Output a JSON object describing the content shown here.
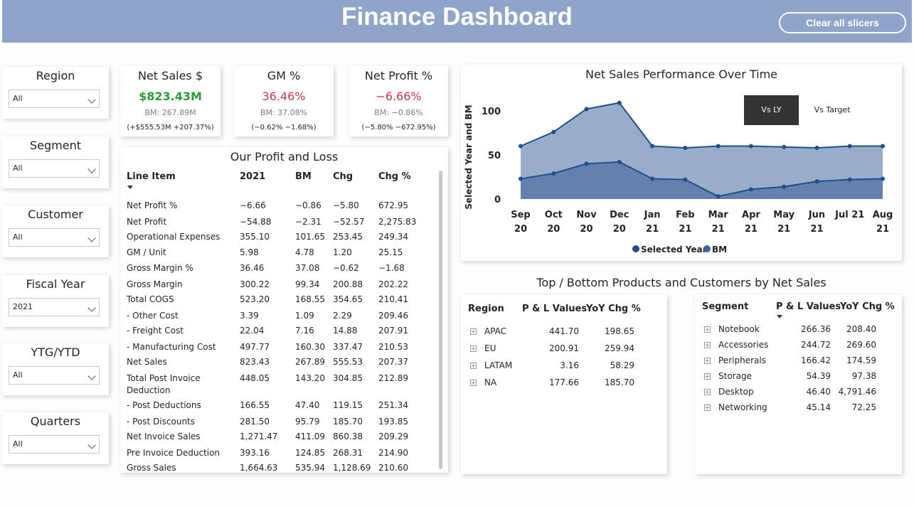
{
  "header": {
    "title": "Finance Dashboard",
    "clear_button": "Clear all slicers"
  },
  "slicers": [
    {
      "title": "Region",
      "value": "All"
    },
    {
      "title": "Segment",
      "value": "All"
    },
    {
      "title": "Customer",
      "value": "All"
    },
    {
      "title": "Fiscal Year",
      "value": "2021"
    },
    {
      "title": "YTG/YTD",
      "value": "All"
    },
    {
      "title": "Quarters",
      "value": "All"
    }
  ],
  "kpis": [
    {
      "title": "Net Sales $",
      "value": "$823.43M",
      "bm": "BM: 267.89M",
      "change": "(+$555.53M +207.37%)",
      "color": "#2e9a3e"
    },
    {
      "title": "GM %",
      "value": "36.46%",
      "bm": "BM: 37.08%",
      "change": "(−0.62% −1.68%)",
      "color": "#c9384a"
    },
    {
      "title": "Net Profit %",
      "value": "−6.66%",
      "bm": "BM: −0.86%",
      "change": "(−5.80% −672.95%)",
      "color": "#c9384a"
    }
  ],
  "pl": {
    "title": "Our Profit and Loss",
    "headers": [
      "Line Item",
      "2021",
      "BM",
      "Chg",
      "Chg %"
    ],
    "rows": [
      [
        "Net Profit %",
        "−6.66",
        "−0.86",
        "−5.80",
        "672.95"
      ],
      [
        "Net Profit",
        "−54.88",
        "−2.31",
        "−52.57",
        "2,275.83"
      ],
      [
        "Operational Expenses",
        "355.10",
        "101.65",
        "253.45",
        "249.34"
      ],
      [
        "GM / Unit",
        "5.98",
        "4.78",
        "1.20",
        "25.15"
      ],
      [
        "Gross Margin %",
        "36.46",
        "37.08",
        "−0.62",
        "−1.68"
      ],
      [
        "Gross Margin",
        "300.22",
        "99.34",
        "200.88",
        "202.22"
      ],
      [
        "Total COGS",
        "523.20",
        "168.55",
        "354.65",
        "210.41"
      ],
      [
        "- Other Cost",
        "3.39",
        "1.09",
        "2.29",
        "209.46"
      ],
      [
        "- Freight Cost",
        "22.04",
        "7.16",
        "14.88",
        "207.91"
      ],
      [
        "- Manufacturing Cost",
        "497.77",
        "160.30",
        "337.47",
        "210.53"
      ],
      [
        "Net Sales",
        "823.43",
        "267.89",
        "555.53",
        "207.37"
      ],
      [
        "Total Post Invoice",
        "448.05",
        "143.20",
        "304.85",
        "212.89"
      ],
      [
        "- Post Deductions",
        "166.55",
        "47.40",
        "119.15",
        "251.34"
      ],
      [
        "- Post Discounts",
        "281.50",
        "95.79",
        "185.70",
        "193.85"
      ],
      [
        "Net Invoice Sales",
        "1,271.47",
        "411.09",
        "860.38",
        "209.29"
      ],
      [
        "Pre Invoice Deduction",
        "393.16",
        "124.85",
        "268.31",
        "214.90"
      ],
      [
        "Gross Sales",
        "1,664.63",
        "535.94",
        "1,128.69",
        "210.60"
      ]
    ],
    "wrap_text": "Deduction"
  },
  "chart": {
    "title": "Net Sales Performance Over Time",
    "toggle_on": "Vs LY",
    "toggle_off": "Vs Target",
    "legend": [
      "Selected Year",
      "BM"
    ]
  },
  "chart_data": {
    "type": "area",
    "title": "Net Sales Performance Over Time",
    "ylabel": "Selected Year and BM",
    "xlabel": "",
    "ylim": [
      0,
      120
    ],
    "yticks": [
      0,
      50,
      100
    ],
    "x": [
      [
        "Sep",
        "20"
      ],
      [
        "Oct",
        "20"
      ],
      [
        "Nov",
        "20"
      ],
      [
        "Dec",
        "20"
      ],
      [
        "Jan",
        "21"
      ],
      [
        "Feb",
        "21"
      ],
      [
        "Mar",
        "21"
      ],
      [
        "Apr",
        "21"
      ],
      [
        "May",
        "21"
      ],
      [
        "Jun",
        "21"
      ],
      [
        "Jul 21",
        ""
      ],
      [
        "Aug",
        "21"
      ]
    ],
    "series": [
      {
        "name": "Selected Year",
        "values": [
          60,
          76,
          102,
          109,
          60,
          58,
          60,
          60,
          59,
          58,
          60,
          60
        ],
        "color": "#98adc8",
        "line": "#1f4e8c"
      },
      {
        "name": "BM",
        "values": [
          23,
          29,
          40,
          42,
          23,
          22,
          3,
          11,
          14,
          20,
          22,
          23
        ],
        "color": "#6680ad",
        "line": "#1f4e8c"
      }
    ],
    "legend_position": "bottom"
  },
  "topbottom": {
    "title": "Top / Bottom Products and Customers by Net Sales",
    "region_table": {
      "headers": [
        "Region",
        "P & L Values",
        "YoY Chg %"
      ],
      "rows": [
        [
          "APAC",
          "441.70",
          "198.65"
        ],
        [
          "EU",
          "200.91",
          "259.94"
        ],
        [
          "LATAM",
          "3.16",
          "58.29"
        ],
        [
          "NA",
          "177.66",
          "185.70"
        ]
      ]
    },
    "segment_table": {
      "headers": [
        "Segment",
        "P & L Values",
        "YoY Chg %"
      ],
      "rows": [
        [
          "Notebook",
          "266.36",
          "208.40"
        ],
        [
          "Accessories",
          "244.72",
          "269.60"
        ],
        [
          "Peripherals",
          "166.42",
          "174.59"
        ],
        [
          "Storage",
          "54.39",
          "97.38"
        ],
        [
          "Desktop",
          "46.40",
          "4,791.46"
        ],
        [
          "Networking",
          "45.14",
          "72.25"
        ]
      ]
    }
  }
}
